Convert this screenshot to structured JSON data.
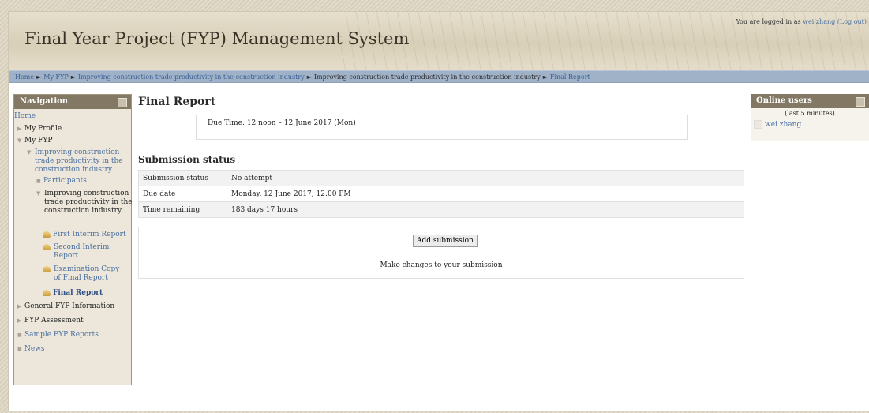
{
  "header": {
    "site_title": "Final Year Project (FYP) Management System",
    "login_prefix": "You are logged in as",
    "user_name": "wei zhang",
    "logout_label": "(Log out)"
  },
  "breadcrumb": [
    {
      "label": "Home"
    },
    {
      "label": "My FYP"
    },
    {
      "label": "Improving construction trade productivity in the construction industry"
    },
    {
      "label": "Improving construction trade productivity in the construction industry"
    },
    {
      "label": "Final Report"
    }
  ],
  "navigation": {
    "title": "Navigation",
    "items": [
      {
        "label": "Home"
      },
      {
        "label": "My Profile"
      },
      {
        "label": "My FYP"
      },
      {
        "label": "Improving construction trade productivity in the construction industry"
      },
      {
        "label": "Participants"
      },
      {
        "label": "Improving construction trade productivity in the construction industry"
      },
      {
        "label": "First Interim Report"
      },
      {
        "label": "Second Interim Report"
      },
      {
        "label": "Examination Copy of Final Report"
      },
      {
        "label": "Final Report"
      },
      {
        "label": "General FYP Information"
      },
      {
        "label": "FYP Assessment"
      },
      {
        "label": "Sample FYP Reports"
      },
      {
        "label": "News"
      }
    ]
  },
  "main": {
    "title": "Final Report",
    "due_time": "Due Time: 12 noon – 12 June 2017 (Mon)",
    "status_heading": "Submission status",
    "status_rows": [
      {
        "label": "Submission status",
        "value": "No attempt"
      },
      {
        "label": "Due date",
        "value": "Monday, 12 June 2017, 12:00 PM"
      },
      {
        "label": "Time remaining",
        "value": "183 days 17 hours"
      }
    ],
    "add_submission_label": "Add submission",
    "submit_hint": "Make changes to your submission"
  },
  "online_users": {
    "title": "Online users",
    "subtitle": "(last 5 minutes)",
    "users": [
      {
        "name": "wei zhang"
      }
    ]
  },
  "colors": {
    "link": "#4a6fa0",
    "navbar_bg": "#9fb2c8",
    "block_header_bg": "#837864"
  }
}
